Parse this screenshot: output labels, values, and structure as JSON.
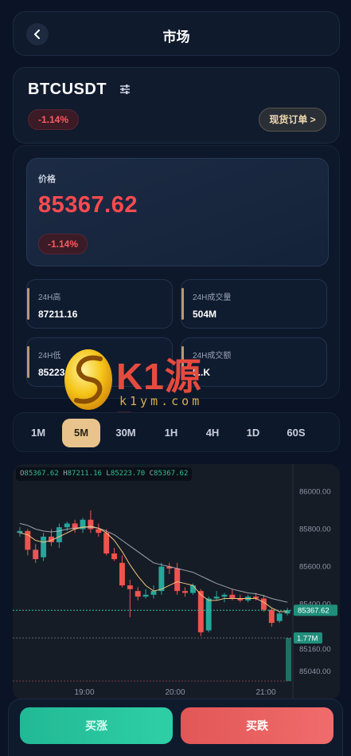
{
  "header": {
    "title": "市场"
  },
  "symbol": {
    "name": "BTCUSDT",
    "change_pct": "-1.14%",
    "spot_order_label": "现货订单 >"
  },
  "price": {
    "label": "价格",
    "value": "85367.62",
    "change_pct": "-1.14%"
  },
  "stats": [
    {
      "label": "24H高",
      "value": "87211.16"
    },
    {
      "label": "24H成交量",
      "value": "504M"
    },
    {
      "label": "24H低",
      "value": "85223.70"
    },
    {
      "label": "24H成交额",
      "value": "5..K"
    }
  ],
  "watermark": {
    "text": "K1源码",
    "sub": "k1ym.com"
  },
  "timeframes": {
    "items": [
      "1M",
      "5M",
      "30M",
      "1H",
      "4H",
      "1D",
      "60S"
    ],
    "active": "5M"
  },
  "chart_data": {
    "type": "candlestick",
    "ohlc_readout": {
      "O": "85367.62",
      "H": "87211.16",
      "L": "85223.70",
      "C": "85367.62"
    },
    "y_tick_labels": [
      "86000.00",
      "85800.00",
      "85600.00",
      "85400.00",
      "85160.00",
      "85040.00"
    ],
    "x_tick_labels": [
      "19:00",
      "20:00",
      "21:00"
    ],
    "ylim": [
      84990,
      86070
    ],
    "last_price_label": "85367.62",
    "volume_label": "1.77M",
    "candles": [
      {
        "o": 85780,
        "h": 85810,
        "l": 85760,
        "c": 85790
      },
      {
        "o": 85790,
        "h": 85800,
        "l": 85660,
        "c": 85690
      },
      {
        "o": 85690,
        "h": 85720,
        "l": 85620,
        "c": 85640
      },
      {
        "o": 85650,
        "h": 85780,
        "l": 85630,
        "c": 85760
      },
      {
        "o": 85760,
        "h": 85800,
        "l": 85710,
        "c": 85730
      },
      {
        "o": 85730,
        "h": 85830,
        "l": 85700,
        "c": 85810
      },
      {
        "o": 85810,
        "h": 85840,
        "l": 85790,
        "c": 85830
      },
      {
        "o": 85830,
        "h": 85850,
        "l": 85780,
        "c": 85800
      },
      {
        "o": 85800,
        "h": 85860,
        "l": 85780,
        "c": 85850
      },
      {
        "o": 85850,
        "h": 85900,
        "l": 85780,
        "c": 85800
      },
      {
        "o": 85800,
        "h": 85830,
        "l": 85760,
        "c": 85780
      },
      {
        "o": 85780,
        "h": 85800,
        "l": 85660,
        "c": 85670
      },
      {
        "o": 85670,
        "h": 85700,
        "l": 85630,
        "c": 85640
      },
      {
        "o": 85620,
        "h": 85660,
        "l": 85490,
        "c": 85500
      },
      {
        "o": 85500,
        "h": 85530,
        "l": 85330,
        "c": 85480
      },
      {
        "o": 85470,
        "h": 85490,
        "l": 85420,
        "c": 85440
      },
      {
        "o": 85440,
        "h": 85480,
        "l": 85430,
        "c": 85450
      },
      {
        "o": 85450,
        "h": 85500,
        "l": 85430,
        "c": 85470
      },
      {
        "o": 85470,
        "h": 85620,
        "l": 85450,
        "c": 85600
      },
      {
        "o": 85600,
        "h": 85620,
        "l": 85560,
        "c": 85590
      },
      {
        "o": 85590,
        "h": 85620,
        "l": 85450,
        "c": 85470
      },
      {
        "o": 85470,
        "h": 85490,
        "l": 85440,
        "c": 85460
      },
      {
        "o": 85460,
        "h": 85510,
        "l": 85450,
        "c": 85500
      },
      {
        "o": 85470,
        "h": 85480,
        "l": 85230,
        "c": 85250
      },
      {
        "o": 85260,
        "h": 85440,
        "l": 85250,
        "c": 85430
      },
      {
        "o": 85430,
        "h": 85470,
        "l": 85420,
        "c": 85440
      },
      {
        "o": 85440,
        "h": 85460,
        "l": 85410,
        "c": 85450
      },
      {
        "o": 85450,
        "h": 85480,
        "l": 85420,
        "c": 85430
      },
      {
        "o": 85430,
        "h": 85450,
        "l": 85410,
        "c": 85420
      },
      {
        "o": 85420,
        "h": 85450,
        "l": 85410,
        "c": 85440
      },
      {
        "o": 85440,
        "h": 85460,
        "l": 85420,
        "c": 85430
      },
      {
        "o": 85430,
        "h": 85450,
        "l": 85360,
        "c": 85370
      },
      {
        "o": 85370,
        "h": 85380,
        "l": 85280,
        "c": 85300
      },
      {
        "o": 85310,
        "h": 85360,
        "l": 85300,
        "c": 85350
      },
      {
        "o": 85350,
        "h": 85380,
        "l": 85340,
        "c": 85367.62
      }
    ],
    "ma_short": [
      85780,
      85770,
      85740,
      85730,
      85740,
      85760,
      85780,
      85800,
      85810,
      85815,
      85805,
      85780,
      85740,
      85680,
      85610,
      85550,
      85500,
      85470,
      85480,
      85500,
      85520,
      85510,
      85500,
      85450,
      85420,
      85420,
      85430,
      85430,
      85430,
      85430,
      85430,
      85410,
      85380,
      85360,
      85360
    ],
    "ma_long": [
      85830,
      85820,
      85800,
      85790,
      85785,
      85790,
      85800,
      85805,
      85810,
      85810,
      85805,
      85790,
      85770,
      85740,
      85710,
      85680,
      85650,
      85620,
      85610,
      85600,
      85590,
      85580,
      85570,
      85550,
      85530,
      85510,
      85495,
      85480,
      85470,
      85460,
      85455,
      85445,
      85430,
      85420,
      85410
    ]
  },
  "actions": {
    "buy_up": "买涨",
    "buy_down": "买跌"
  },
  "colors": {
    "up": "#26a69a",
    "down": "#ef5350",
    "accent": "#e8c48c",
    "negative": "#ff4a4f"
  }
}
